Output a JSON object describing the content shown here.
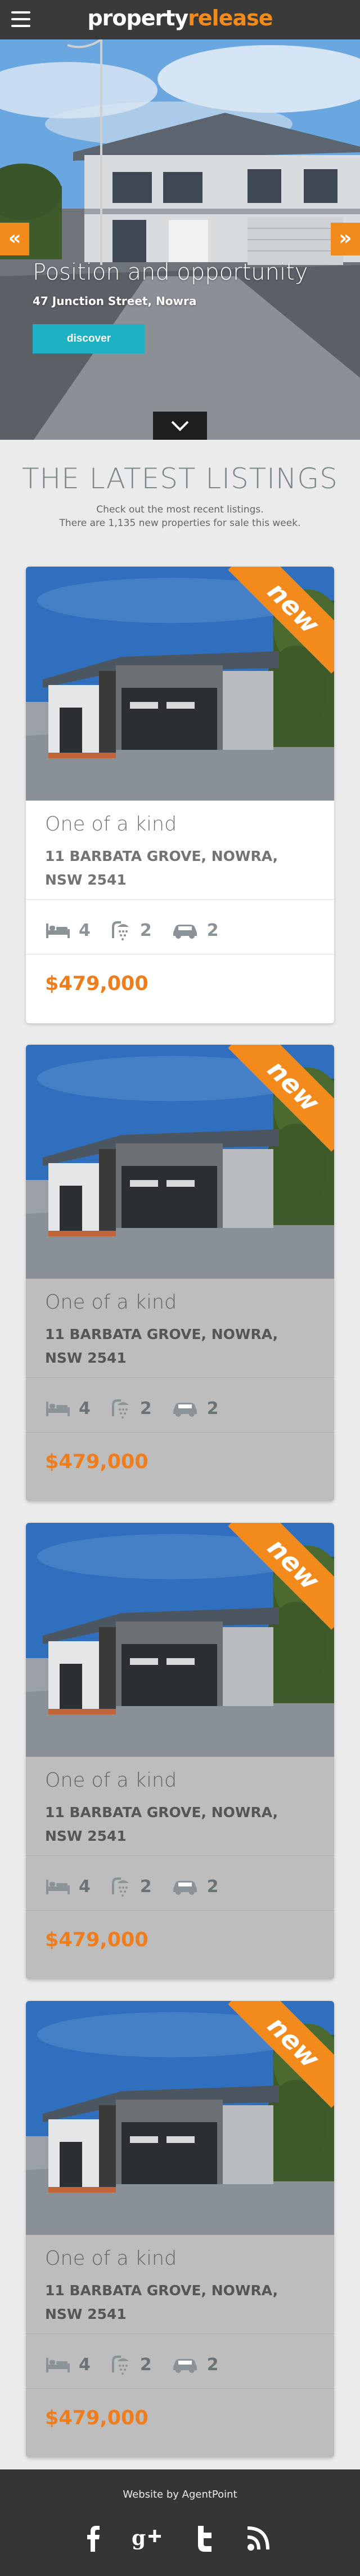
{
  "header": {
    "logo_part1": "property",
    "logo_part2": "release"
  },
  "hero": {
    "title": "Position and opportunity",
    "address": "47 Junction Street, Nowra",
    "button": "discover",
    "prev_icon": "double-chevron-left-icon",
    "next_icon": "double-chevron-right-icon"
  },
  "listings": {
    "heading": "THE LATEST LISTINGS",
    "sub1": "Check out the most recent listings.",
    "sub2": "There are 1,135 new properties for sale this week.",
    "items": [
      {
        "badge": "new",
        "name": "One of a kind",
        "address": "11 BARBATA GROVE, NOWRA, NSW 2541",
        "beds": "4",
        "baths": "2",
        "cars": "2",
        "price": "$479,000"
      },
      {
        "badge": "new",
        "name": "One of a kind",
        "address": "11 BARBATA GROVE, NOWRA, NSW 2541",
        "beds": "4",
        "baths": "2",
        "cars": "2",
        "price": "$479,000"
      },
      {
        "badge": "new",
        "name": "One of a kind",
        "address": "11 BARBATA GROVE, NOWRA, NSW 2541",
        "beds": "4",
        "baths": "2",
        "cars": "2",
        "price": "$479,000"
      },
      {
        "badge": "new",
        "name": "One of a kind",
        "address": "11 BARBATA GROVE, NOWRA, NSW 2541",
        "beds": "4",
        "baths": "2",
        "cars": "2",
        "price": "$479,000"
      }
    ]
  },
  "footer": {
    "credit": "Website by AgentPoint",
    "social": [
      "facebook-icon",
      "google-plus-icon",
      "twitter-icon",
      "rss-icon"
    ]
  },
  "colors": {
    "accent": "#f28a1c",
    "price": "#f07d1c",
    "button": "#1eb1c4",
    "topbar": "#3a3a3a",
    "footer": "#353535"
  }
}
